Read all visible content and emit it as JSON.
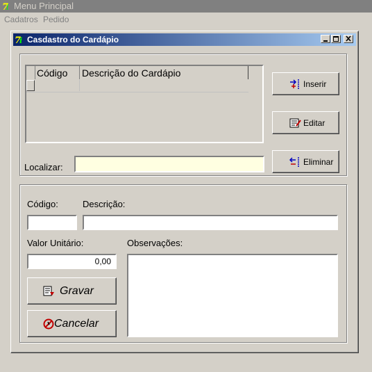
{
  "window": {
    "title": "Menu Principal"
  },
  "menu": {
    "items": [
      "Cadatros",
      "Pedido"
    ]
  },
  "form": {
    "title": "Casdastro do Cardápio"
  },
  "grid": {
    "columns": [
      "Código",
      "Descrição do Cardápio"
    ]
  },
  "search": {
    "label": "Localizar:",
    "value": ""
  },
  "buttons": {
    "insert": "Inserir",
    "edit": "Editar",
    "delete": "Eliminar",
    "save": "Gravar",
    "cancel": "Cancelar"
  },
  "fields": {
    "code_label": "Código:",
    "code_value": "",
    "description_label": "Descrição:",
    "description_value": "",
    "unit_price_label": "Valor Unitário:",
    "unit_price_value": "0,00",
    "notes_label": "Observações:",
    "notes_value": ""
  },
  "colors": {
    "active_title": "#0a246a",
    "input_highlight": "#ffffe1",
    "face": "#d4d0c8"
  }
}
